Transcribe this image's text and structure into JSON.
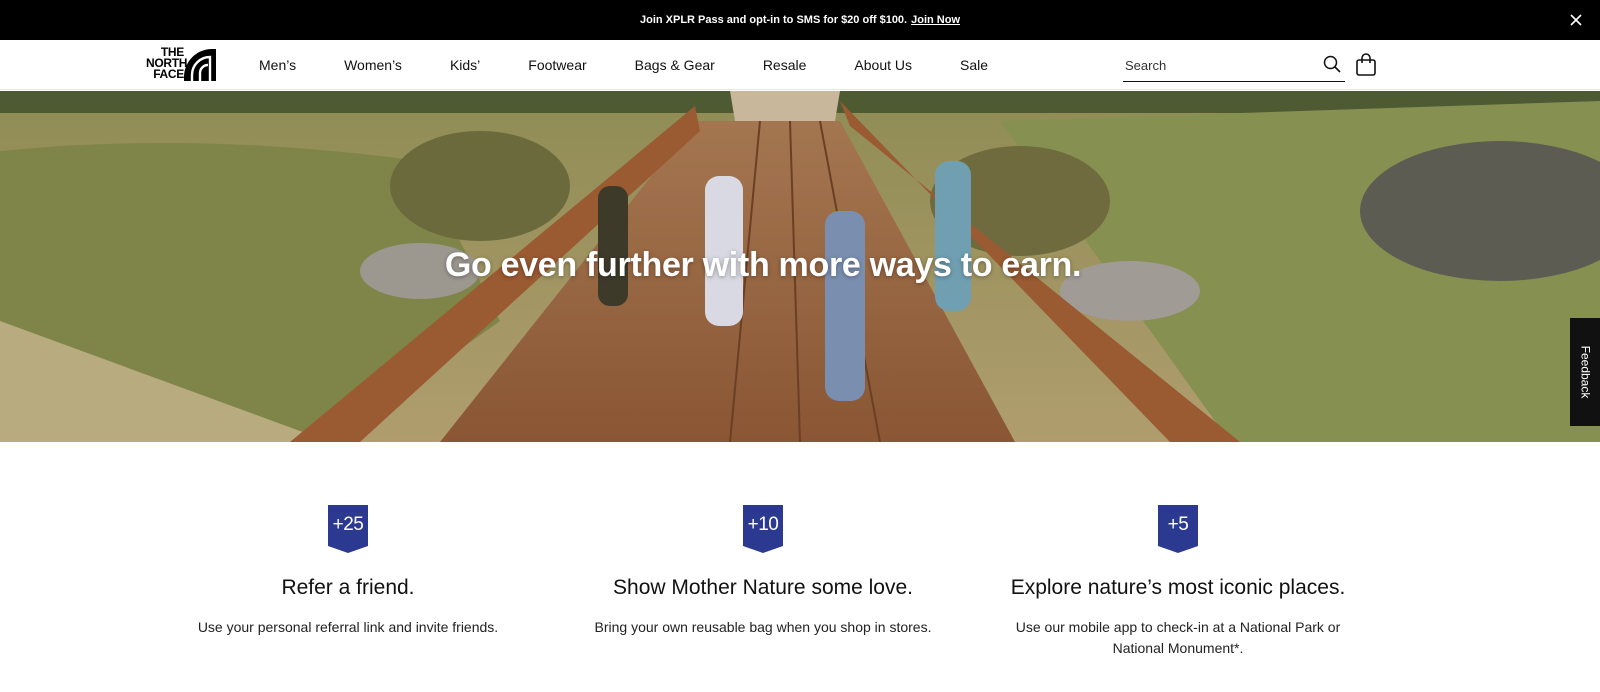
{
  "promo": {
    "text": "Join XPLR Pass and opt-in to SMS for $20 off $100.",
    "link": "Join Now"
  },
  "header": {
    "logo": {
      "line1": "THE",
      "line2": "NORTH",
      "line3": "FACE"
    },
    "nav": [
      "Men’s",
      "Women’s",
      "Kids’",
      "Footwear",
      "Bags & Gear",
      "Resale",
      "About Us",
      "Sale"
    ],
    "search_placeholder": "Search"
  },
  "hero": {
    "title": "Go even further with more ways to earn."
  },
  "feedback": "Feedback",
  "cards": [
    {
      "points": "+25",
      "title": "Refer a friend.",
      "description": "Use your personal referral link and invite friends."
    },
    {
      "points": "+10",
      "title": "Show Mother Nature some love.",
      "description": "Bring your own reusable bag when you shop in stores."
    },
    {
      "points": "+5",
      "title": "Explore nature’s most iconic places.",
      "description": "Use our mobile app to check-in at a National Park or National Monument*."
    }
  ],
  "colors": {
    "badge": "#2b3990",
    "promo_bg": "#000000",
    "text": "#111111"
  },
  "icons": {
    "close": "close-icon",
    "search": "search-icon",
    "cart": "shopping-bag-icon"
  }
}
